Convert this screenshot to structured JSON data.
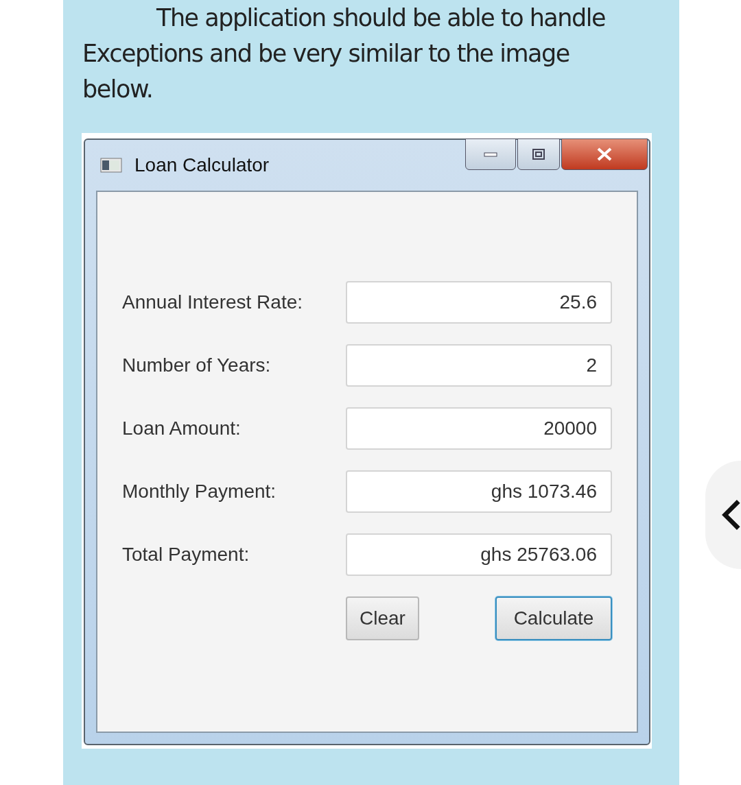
{
  "post_text": "The application should be able to handle Exceptions and be very similar to the image below.",
  "window": {
    "title": "Loan Calculator"
  },
  "fields": [
    {
      "label": "Annual Interest Rate:",
      "value": "25.6"
    },
    {
      "label": "Number of Years:",
      "value": "2"
    },
    {
      "label": "Loan Amount:",
      "value": "20000"
    },
    {
      "label": "Monthly Payment:",
      "value": "ghs 1073.46"
    },
    {
      "label": "Total Payment:",
      "value": "ghs 25763.06"
    }
  ],
  "buttons": [
    {
      "label": "Clear",
      "focused": false
    },
    {
      "label": "Calculate",
      "focused": true
    }
  ]
}
